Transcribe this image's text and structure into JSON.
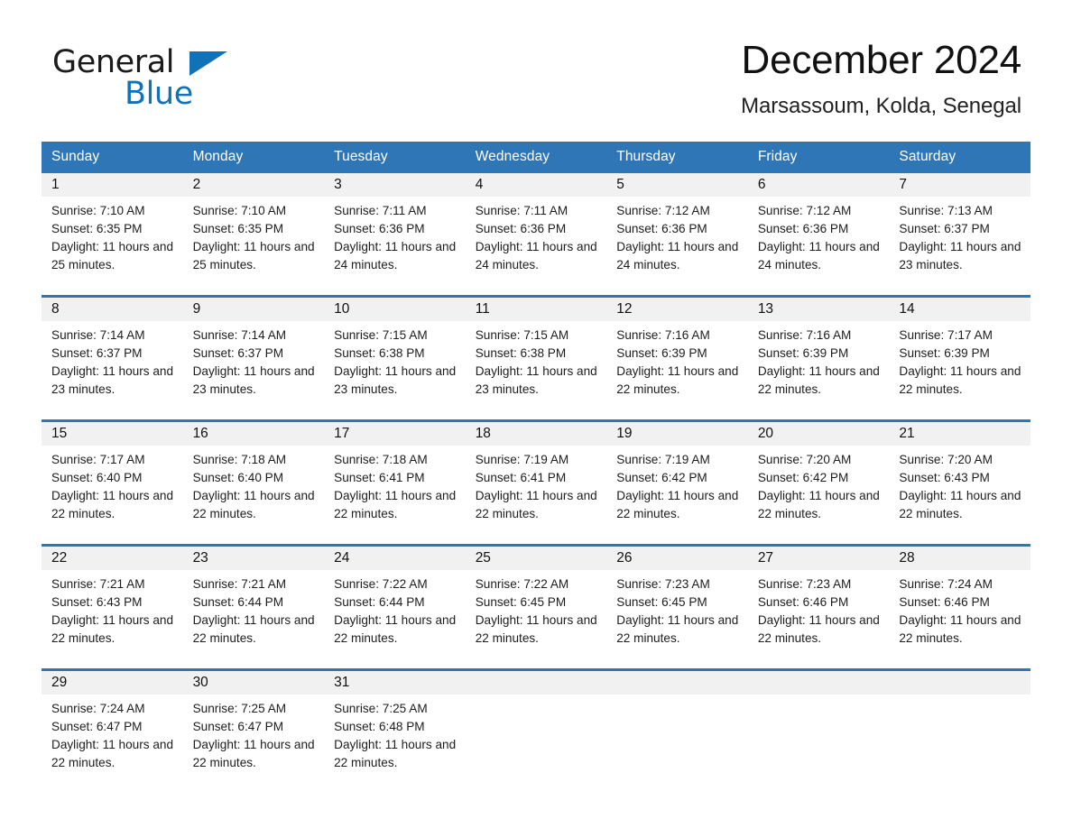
{
  "logo": {
    "word1": "General",
    "word2": "Blue",
    "triangle_color": "#1272b8"
  },
  "header": {
    "title": "December 2024",
    "subtitle": "Marsassoum, Kolda, Senegal"
  },
  "theme": {
    "header_blue": "#2e76b6",
    "daynum_gray": "#f1f1f1",
    "text": "#1d1d1d"
  },
  "weekday_headers": [
    "Sunday",
    "Monday",
    "Tuesday",
    "Wednesday",
    "Thursday",
    "Friday",
    "Saturday"
  ],
  "labels": {
    "sunrise_prefix": "Sunrise: ",
    "sunset_prefix": "Sunset: ",
    "daylight_prefix": "Daylight: "
  },
  "weeks": [
    [
      {
        "day": "1",
        "sunrise": "Sunrise: 7:10 AM",
        "sunset": "Sunset: 6:35 PM",
        "daylight": "Daylight: 11 hours and 25 minutes."
      },
      {
        "day": "2",
        "sunrise": "Sunrise: 7:10 AM",
        "sunset": "Sunset: 6:35 PM",
        "daylight": "Daylight: 11 hours and 25 minutes."
      },
      {
        "day": "3",
        "sunrise": "Sunrise: 7:11 AM",
        "sunset": "Sunset: 6:36 PM",
        "daylight": "Daylight: 11 hours and 24 minutes."
      },
      {
        "day": "4",
        "sunrise": "Sunrise: 7:11 AM",
        "sunset": "Sunset: 6:36 PM",
        "daylight": "Daylight: 11 hours and 24 minutes."
      },
      {
        "day": "5",
        "sunrise": "Sunrise: 7:12 AM",
        "sunset": "Sunset: 6:36 PM",
        "daylight": "Daylight: 11 hours and 24 minutes."
      },
      {
        "day": "6",
        "sunrise": "Sunrise: 7:12 AM",
        "sunset": "Sunset: 6:36 PM",
        "daylight": "Daylight: 11 hours and 24 minutes."
      },
      {
        "day": "7",
        "sunrise": "Sunrise: 7:13 AM",
        "sunset": "Sunset: 6:37 PM",
        "daylight": "Daylight: 11 hours and 23 minutes."
      }
    ],
    [
      {
        "day": "8",
        "sunrise": "Sunrise: 7:14 AM",
        "sunset": "Sunset: 6:37 PM",
        "daylight": "Daylight: 11 hours and 23 minutes."
      },
      {
        "day": "9",
        "sunrise": "Sunrise: 7:14 AM",
        "sunset": "Sunset: 6:37 PM",
        "daylight": "Daylight: 11 hours and 23 minutes."
      },
      {
        "day": "10",
        "sunrise": "Sunrise: 7:15 AM",
        "sunset": "Sunset: 6:38 PM",
        "daylight": "Daylight: 11 hours and 23 minutes."
      },
      {
        "day": "11",
        "sunrise": "Sunrise: 7:15 AM",
        "sunset": "Sunset: 6:38 PM",
        "daylight": "Daylight: 11 hours and 23 minutes."
      },
      {
        "day": "12",
        "sunrise": "Sunrise: 7:16 AM",
        "sunset": "Sunset: 6:39 PM",
        "daylight": "Daylight: 11 hours and 22 minutes."
      },
      {
        "day": "13",
        "sunrise": "Sunrise: 7:16 AM",
        "sunset": "Sunset: 6:39 PM",
        "daylight": "Daylight: 11 hours and 22 minutes."
      },
      {
        "day": "14",
        "sunrise": "Sunrise: 7:17 AM",
        "sunset": "Sunset: 6:39 PM",
        "daylight": "Daylight: 11 hours and 22 minutes."
      }
    ],
    [
      {
        "day": "15",
        "sunrise": "Sunrise: 7:17 AM",
        "sunset": "Sunset: 6:40 PM",
        "daylight": "Daylight: 11 hours and 22 minutes."
      },
      {
        "day": "16",
        "sunrise": "Sunrise: 7:18 AM",
        "sunset": "Sunset: 6:40 PM",
        "daylight": "Daylight: 11 hours and 22 minutes."
      },
      {
        "day": "17",
        "sunrise": "Sunrise: 7:18 AM",
        "sunset": "Sunset: 6:41 PM",
        "daylight": "Daylight: 11 hours and 22 minutes."
      },
      {
        "day": "18",
        "sunrise": "Sunrise: 7:19 AM",
        "sunset": "Sunset: 6:41 PM",
        "daylight": "Daylight: 11 hours and 22 minutes."
      },
      {
        "day": "19",
        "sunrise": "Sunrise: 7:19 AM",
        "sunset": "Sunset: 6:42 PM",
        "daylight": "Daylight: 11 hours and 22 minutes."
      },
      {
        "day": "20",
        "sunrise": "Sunrise: 7:20 AM",
        "sunset": "Sunset: 6:42 PM",
        "daylight": "Daylight: 11 hours and 22 minutes."
      },
      {
        "day": "21",
        "sunrise": "Sunrise: 7:20 AM",
        "sunset": "Sunset: 6:43 PM",
        "daylight": "Daylight: 11 hours and 22 minutes."
      }
    ],
    [
      {
        "day": "22",
        "sunrise": "Sunrise: 7:21 AM",
        "sunset": "Sunset: 6:43 PM",
        "daylight": "Daylight: 11 hours and 22 minutes."
      },
      {
        "day": "23",
        "sunrise": "Sunrise: 7:21 AM",
        "sunset": "Sunset: 6:44 PM",
        "daylight": "Daylight: 11 hours and 22 minutes."
      },
      {
        "day": "24",
        "sunrise": "Sunrise: 7:22 AM",
        "sunset": "Sunset: 6:44 PM",
        "daylight": "Daylight: 11 hours and 22 minutes."
      },
      {
        "day": "25",
        "sunrise": "Sunrise: 7:22 AM",
        "sunset": "Sunset: 6:45 PM",
        "daylight": "Daylight: 11 hours and 22 minutes."
      },
      {
        "day": "26",
        "sunrise": "Sunrise: 7:23 AM",
        "sunset": "Sunset: 6:45 PM",
        "daylight": "Daylight: 11 hours and 22 minutes."
      },
      {
        "day": "27",
        "sunrise": "Sunrise: 7:23 AM",
        "sunset": "Sunset: 6:46 PM",
        "daylight": "Daylight: 11 hours and 22 minutes."
      },
      {
        "day": "28",
        "sunrise": "Sunrise: 7:24 AM",
        "sunset": "Sunset: 6:46 PM",
        "daylight": "Daylight: 11 hours and 22 minutes."
      }
    ],
    [
      {
        "day": "29",
        "sunrise": "Sunrise: 7:24 AM",
        "sunset": "Sunset: 6:47 PM",
        "daylight": "Daylight: 11 hours and 22 minutes."
      },
      {
        "day": "30",
        "sunrise": "Sunrise: 7:25 AM",
        "sunset": "Sunset: 6:47 PM",
        "daylight": "Daylight: 11 hours and 22 minutes."
      },
      {
        "day": "31",
        "sunrise": "Sunrise: 7:25 AM",
        "sunset": "Sunset: 6:48 PM",
        "daylight": "Daylight: 11 hours and 22 minutes."
      },
      {
        "day": "",
        "sunrise": "",
        "sunset": "",
        "daylight": ""
      },
      {
        "day": "",
        "sunrise": "",
        "sunset": "",
        "daylight": ""
      },
      {
        "day": "",
        "sunrise": "",
        "sunset": "",
        "daylight": ""
      },
      {
        "day": "",
        "sunrise": "",
        "sunset": "",
        "daylight": ""
      }
    ]
  ]
}
